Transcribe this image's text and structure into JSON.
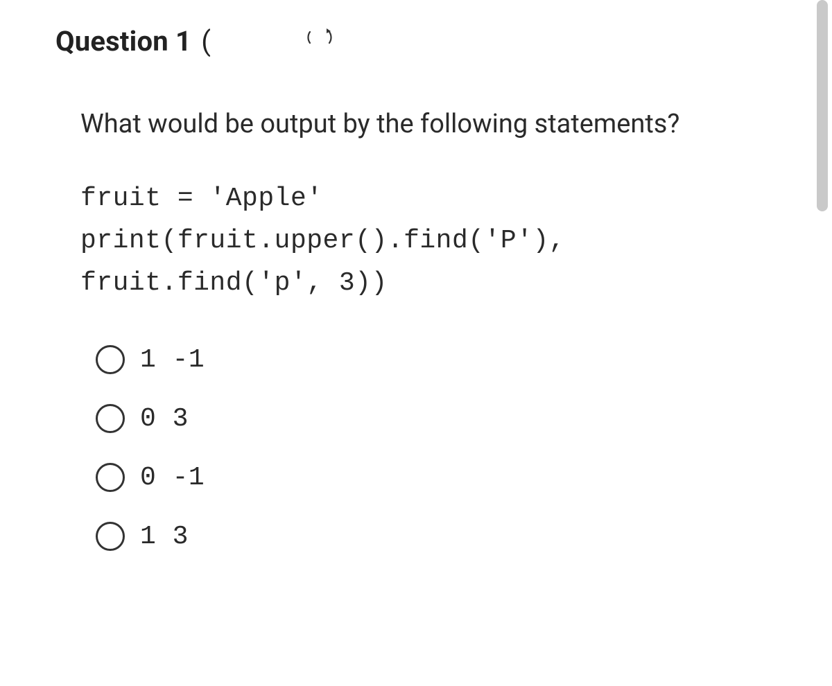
{
  "question": {
    "number_prefix": "Question ",
    "number": "1",
    "paren_open": " (",
    "prompt": "What would be output by the following statements?",
    "code_lines": [
      "fruit = 'Apple'",
      "print(fruit.upper().find('P'),",
      "fruit.find('p', 3))"
    ],
    "options": [
      {
        "label": "1 -1"
      },
      {
        "label": "0 3"
      },
      {
        "label": "0 -1"
      },
      {
        "label": "1 3"
      }
    ]
  }
}
